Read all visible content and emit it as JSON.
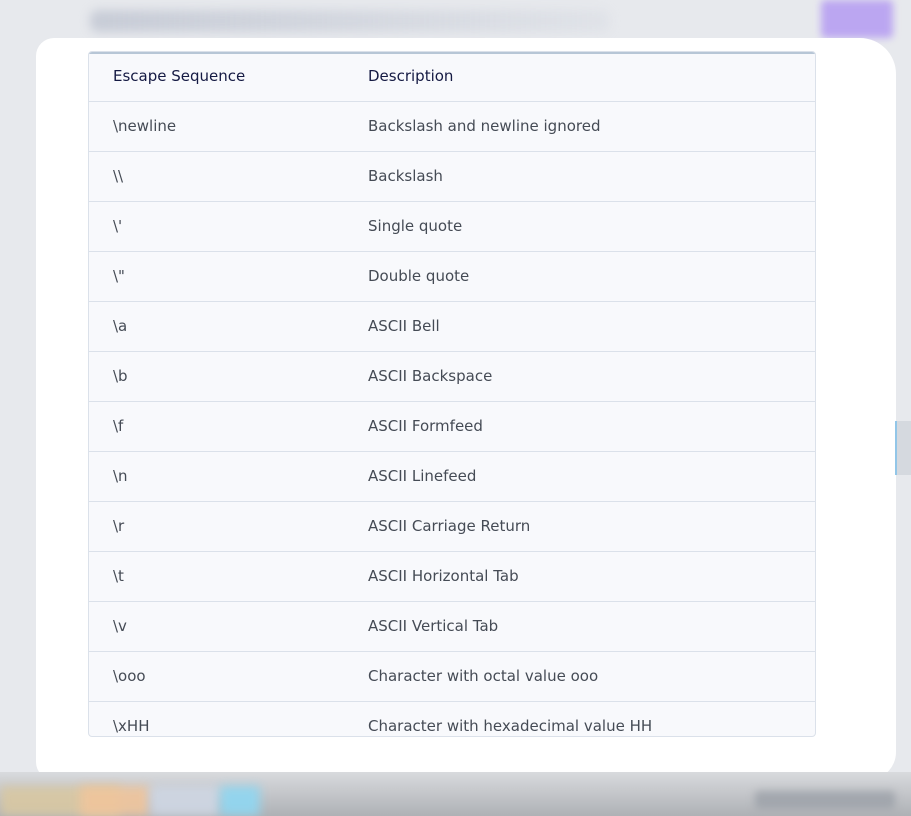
{
  "table": {
    "headers": {
      "sequence": "Escape Sequence",
      "description": "Description"
    },
    "rows": [
      {
        "sequence": "\\newline",
        "description": "Backslash and newline ignored"
      },
      {
        "sequence": "\\\\",
        "description": "Backslash"
      },
      {
        "sequence": "\\'",
        "description": "Single quote"
      },
      {
        "sequence": "\\\"",
        "description": "Double quote"
      },
      {
        "sequence": "\\a",
        "description": "ASCII Bell"
      },
      {
        "sequence": "\\b",
        "description": "ASCII Backspace"
      },
      {
        "sequence": "\\f",
        "description": "ASCII Formfeed"
      },
      {
        "sequence": "\\n",
        "description": "ASCII Linefeed"
      },
      {
        "sequence": "\\r",
        "description": "ASCII Carriage Return"
      },
      {
        "sequence": "\\t",
        "description": "ASCII Horizontal Tab"
      },
      {
        "sequence": "\\v",
        "description": "ASCII Vertical Tab"
      },
      {
        "sequence": "\\ooo",
        "description": "Character with octal value ooo"
      },
      {
        "sequence": "\\xHH",
        "description": "Character with hexadecimal value HH"
      }
    ]
  },
  "colors": {
    "background": "#eceef1",
    "card": "#f8f9fc",
    "border": "#dbe1ea",
    "header_text": "#151a43",
    "body_text": "#454b55",
    "accent": "#b79ff2"
  }
}
